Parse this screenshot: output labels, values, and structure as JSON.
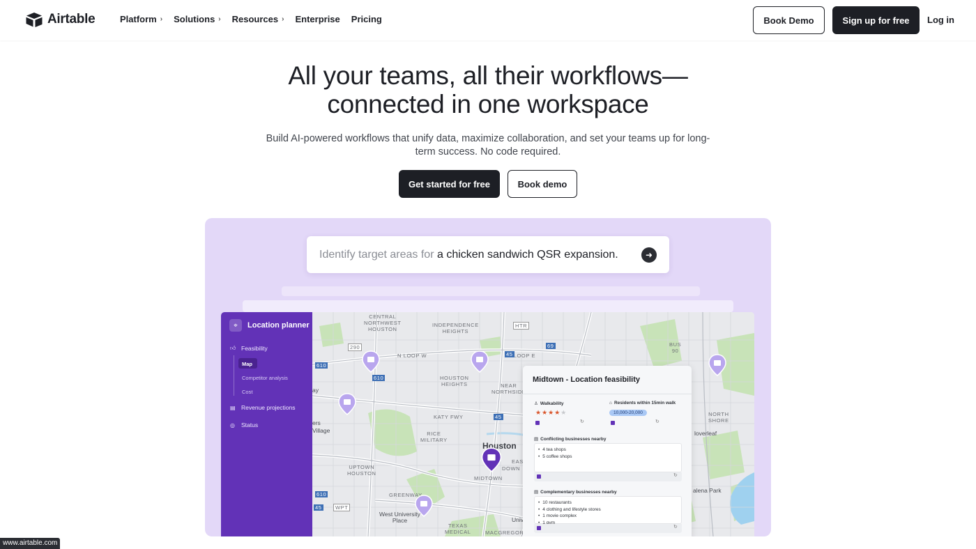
{
  "brand": {
    "name": "Airtable"
  },
  "nav": {
    "links": [
      {
        "label": "Platform",
        "has_menu": true
      },
      {
        "label": "Solutions",
        "has_menu": true
      },
      {
        "label": "Resources",
        "has_menu": true
      },
      {
        "label": "Enterprise",
        "has_menu": false
      },
      {
        "label": "Pricing",
        "has_menu": false
      }
    ],
    "book_demo": "Book Demo",
    "signup": "Sign up for free",
    "login": "Log in"
  },
  "hero": {
    "title_line1": "All your teams, all their workflows—",
    "title_line2": "connected in one workspace",
    "subtitle": "Build AI-powered workflows that unify data, maximize collaboration, and set your teams up for long-term success. No code required.",
    "cta_primary": "Get started for free",
    "cta_secondary": "Book demo"
  },
  "prompt": {
    "prefix": "Identify target areas for",
    "emphasis": "a chicken sandwich QSR expansion.",
    "send_icon": "arrow-right-icon"
  },
  "app": {
    "title": "Location planner",
    "sidebar": {
      "feasibility": "Feasibility",
      "sub_items": [
        "Map",
        "Competitor analysis",
        "Cost"
      ],
      "revenue": "Revenue projections",
      "status": "Status"
    },
    "map_labels": {
      "central_nw": "CENTRAL\nNORTHWEST\nHOUSTON",
      "independence": "INDEPENDENCE\nHEIGHTS",
      "n_loop_w": "N LOOP W",
      "n_loop_e": "N LOOP E",
      "houston_heights": "HOUSTON\nHEIGHTS",
      "near_northside": "NEAR\nNORTHSIDE",
      "katy_fwy": "KATY FWY",
      "rice_military": "RICE\nMILITARY",
      "houston": "Houston",
      "uptown": "UPTOWN\nHOUSTON",
      "midtown": "MIDTOWN",
      "greenway": "GREENWAY",
      "west_u": "West University\nPlace",
      "texas_medical": "TEXAS\nMEDICAL",
      "macgregor": "MACGREGOR",
      "north_shore": "NORTH\nSHORE",
      "cloverleaf": "loverleaf",
      "galena_park": "alena Park",
      "village": "Village",
      "ers": "ers",
      "ay": "ay",
      "eas": "EAS",
      "down": "DOWN",
      "univ": "Univ",
      "shields": [
        "290",
        "610",
        "HTR",
        "45",
        "69",
        "610",
        "45",
        "WPT",
        "45",
        "BUS\n90",
        "610"
      ]
    },
    "card": {
      "title": "Midtown - Location feasibility",
      "walkability_label": "Walkability",
      "walkability_rating": 4,
      "walkability_max": 5,
      "residents_label": "Residents within 15min walk",
      "residents_value": "10,000-20,000",
      "conflicting_label": "Conflicting businesses nearby",
      "conflicting": [
        "4 tea shops",
        "5 coffee shops"
      ],
      "complementary_label": "Complementary businesses nearby",
      "complementary": [
        "10 restaurants",
        "4 clothing and lifestyle stores",
        "1 movie complex",
        "1 gym"
      ]
    }
  },
  "status_url": "www.airtable.com",
  "colors": {
    "accent_purple": "#6232b7",
    "showcase_bg": "#e3d8f8",
    "dark": "#1d1f25",
    "star": "#d9552b",
    "badge": "#a9c8f5"
  }
}
